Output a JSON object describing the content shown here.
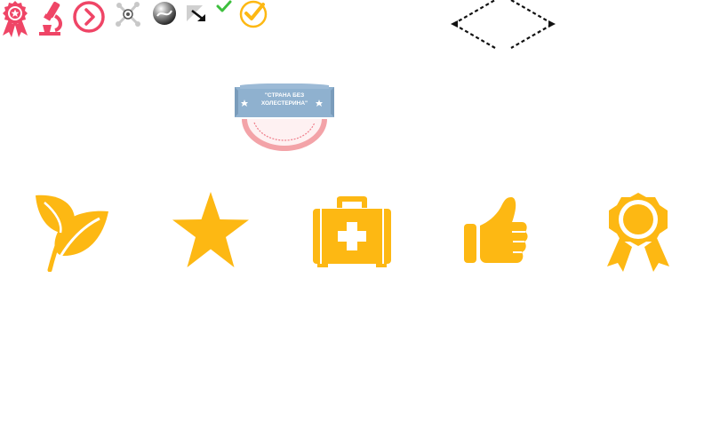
{
  "colors": {
    "pink": "#ef4566",
    "gold": "#fdb813",
    "green": "#3dbf3d",
    "grey": "#c8c8c8",
    "seal_blue": "#8fb1cf",
    "seal_pink": "#f3a3a8"
  },
  "toolbar": {
    "icons": [
      "award-ribbon-icon",
      "microscope-icon",
      "circle-chevron-right-icon",
      "scatter-nodes-icon",
      "sphere-icon",
      "resize-arrow-icon",
      "small-checkmark-icon",
      "circle-checkmark-icon"
    ]
  },
  "seal": {
    "line1": "\"СТРАНА БЕЗ",
    "line2": "ХОЛЕСТЕРИНА\""
  },
  "features": {
    "icons": [
      "leaf-icon",
      "star-icon",
      "first-aid-kit-icon",
      "thumbs-up-icon",
      "medal-icon"
    ]
  }
}
